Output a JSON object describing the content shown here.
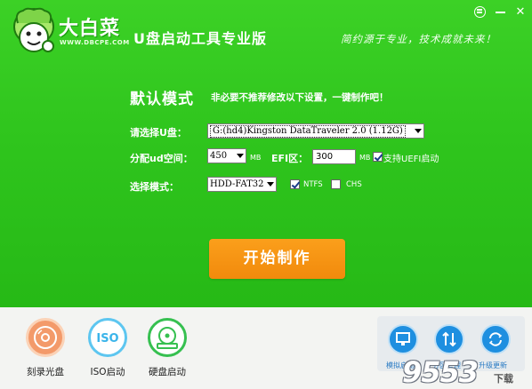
{
  "header": {
    "brand_name": "大白菜",
    "brand_url": "WWW.DBCPE.COM",
    "tool_title": "U盘启动工具专业版",
    "slogan": "简约源于专业，技术成就未来！"
  },
  "window": {
    "menu_icon": "menu-icon",
    "min_icon": "minimize-icon",
    "close_symbol": "✕"
  },
  "form": {
    "mode_title": "默认模式",
    "mode_hint": "非必要不推荐修改以下设置，一键制作吧！",
    "disk_label": "请选择U盘：",
    "disk_value": "G:(hd4)Kingston DataTraveler 2.0 (1.12G)",
    "alloc_label": "分配ud空间：",
    "alloc_value": "450",
    "alloc_unit": "MB",
    "efi_label": "EFI区：",
    "efi_value": "300",
    "efi_unit": "MB",
    "uefi_label": "支持UEFI启动",
    "uefi_checked": true,
    "select_mode_label": "选择模式：",
    "select_mode_value": "HDD-FAT32",
    "ntfs_label": "NTFS",
    "ntfs_checked": true,
    "chs_label": "CHS",
    "chs_checked": false,
    "start_button": "开始制作"
  },
  "bottom_tools": [
    {
      "label": "刻录光盘",
      "icon": "disc-icon",
      "color": "#f39a6a"
    },
    {
      "label": "ISO启动",
      "icon": "iso-icon",
      "color": "#5dc6f0"
    },
    {
      "label": "硬盘启动",
      "icon": "harddisk-icon",
      "color": "#36c050"
    }
  ],
  "right_tools": [
    {
      "label": "模拟启动",
      "icon": "monitor-icon"
    },
    {
      "label": "分区管理",
      "icon": "partition-icon"
    },
    {
      "label": "升级更新",
      "icon": "refresh-icon"
    }
  ],
  "watermark": {
    "text": "9553",
    "sub": "下载"
  },
  "colors": {
    "green": "#2fc51d",
    "orange": "#f18a0c",
    "blue": "#1e8fe0"
  }
}
